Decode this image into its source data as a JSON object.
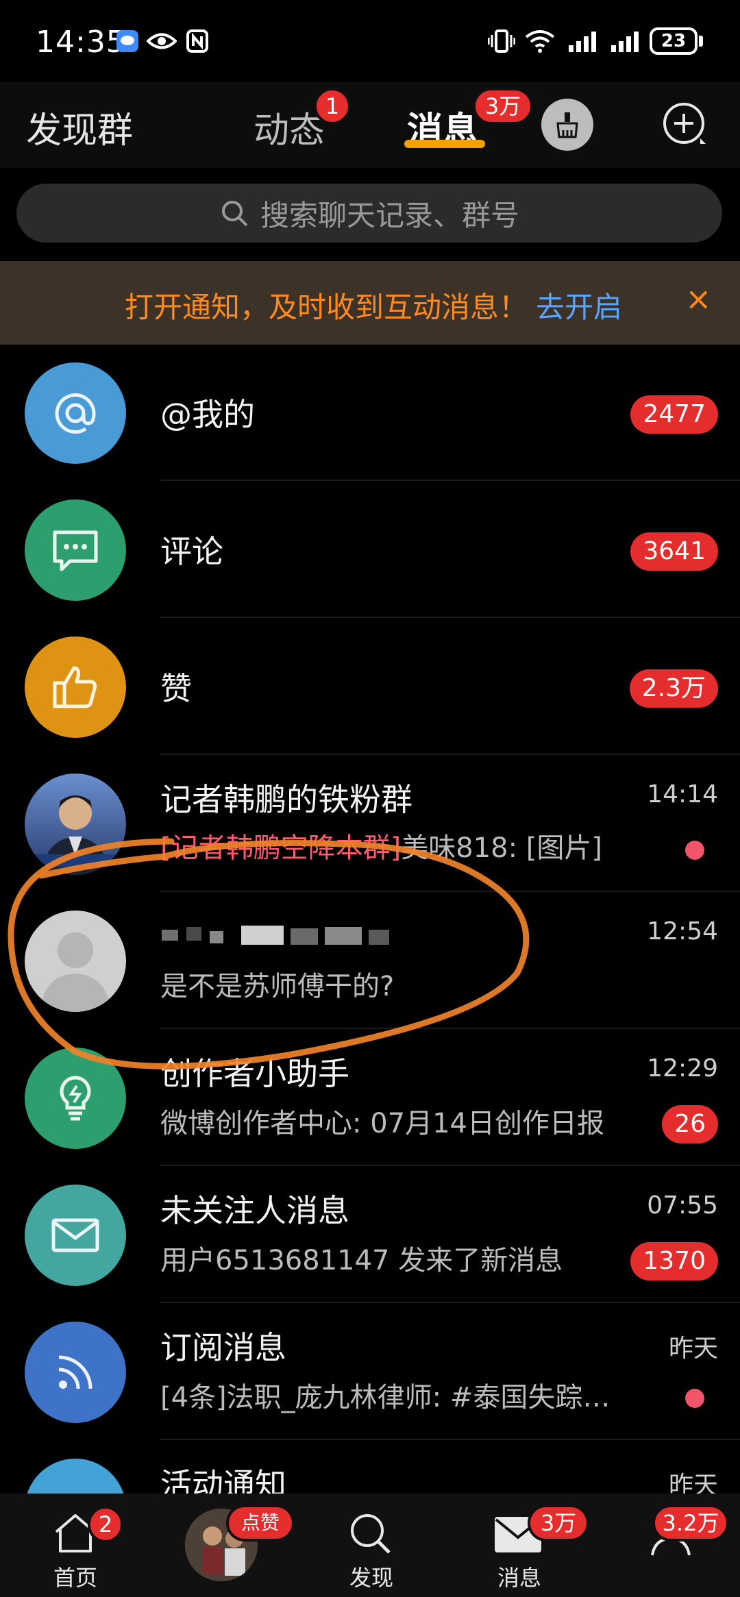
{
  "status_bar": {
    "time": "14:35",
    "battery": "23"
  },
  "header": {
    "tabs": [
      {
        "label": "发现群"
      },
      {
        "label": "动态",
        "badge": "1"
      },
      {
        "label": "消息",
        "badge": "3万"
      }
    ]
  },
  "search": {
    "placeholder": "搜索聊天记录、群号"
  },
  "notice": {
    "text": "打开通知，及时收到互动消息！",
    "link": "去开启",
    "close": "×"
  },
  "messages": [
    {
      "title": "@我的",
      "count": "2477"
    },
    {
      "title": "评论",
      "count": "3641"
    },
    {
      "title": "赞",
      "count": "2.3万"
    },
    {
      "title": "记者韩鹏的铁粉群",
      "time": "14:14",
      "sub_highlight": "[记者韩鹏空降本群]",
      "subtitle": "美味818: [图片]"
    },
    {
      "title": "",
      "time": "12:54",
      "subtitle": "是不是苏师傅干的?"
    },
    {
      "title": "创作者小助手",
      "time": "12:29",
      "subtitle": "微博创作者中心: 07月14日创作日报",
      "count": "26"
    },
    {
      "title": "未关注人消息",
      "time": "07:55",
      "subtitle": "用户6513681147 发来了新消息",
      "count": "1370"
    },
    {
      "title": "订阅消息",
      "time": "昨天",
      "subtitle": "[4条]法职_庞九林律师: #泰国失踪…"
    },
    {
      "title": "活动通知",
      "time": "昨天"
    }
  ],
  "bottom_nav": [
    {
      "label": "首页",
      "badge": "2"
    },
    {
      "label": "",
      "badge": "点赞"
    },
    {
      "label": "发现"
    },
    {
      "label": "消息",
      "badge": "3万"
    },
    {
      "label": "",
      "badge": "3.2万"
    }
  ],
  "colors": {
    "accent": "#f7a000",
    "badge": "#e52d2d",
    "notice_text": "#ff8a1f",
    "link": "#58a6ff"
  }
}
